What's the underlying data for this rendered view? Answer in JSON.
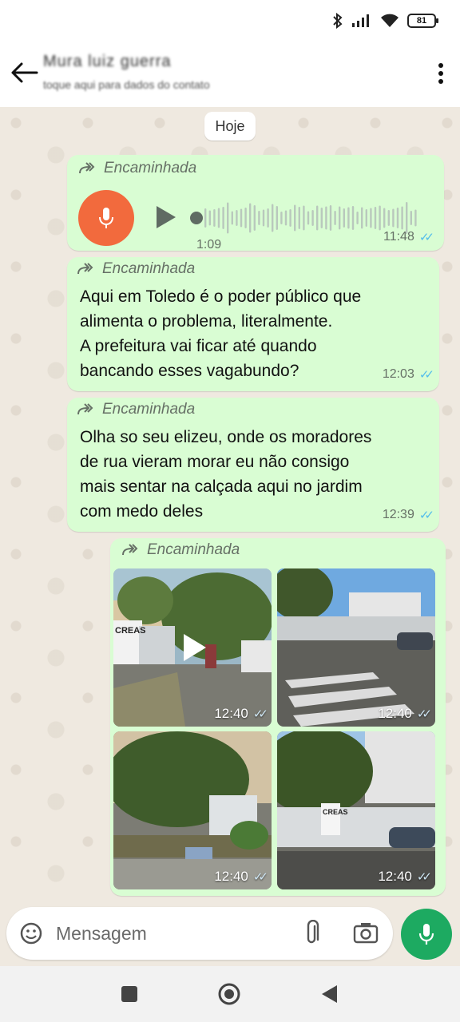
{
  "status_bar": {
    "battery": "81",
    "icons": [
      "bluetooth-icon",
      "signal-icon",
      "wifi-icon"
    ]
  },
  "header": {
    "contact_name": "Mura luiz guerra",
    "contact_subtitle": "toque aqui para dados do contato",
    "icons": [
      "back-arrow-icon",
      "more-vert-icon"
    ]
  },
  "chat": {
    "date_chip": "Hoje",
    "messages": [
      {
        "type": "audio",
        "forward_label": "Encaminhada",
        "duration": "1:09",
        "time": "11:48"
      },
      {
        "type": "text",
        "forward_label": "Encaminhada",
        "lines": [
          "Aqui em Toledo é o poder público que",
          "alimenta o problema, literalmente.",
          "A prefeitura vai ficar até quando",
          "bancando esses vagabundo?"
        ],
        "time": "12:03"
      },
      {
        "type": "text",
        "forward_label": "Encaminhada",
        "lines": [
          "Olha so seu elizeu, onde os moradores",
          "de rua vieram morar eu não consigo",
          "mais sentar na calçada aqui no jardim",
          "com medo deles"
        ],
        "time": "12:39"
      },
      {
        "type": "media",
        "forward_label": "Encaminhada",
        "items": [
          {
            "kind": "video",
            "sign_text": "CREAS",
            "time": "12:40"
          },
          {
            "kind": "photo",
            "time": "12:40"
          },
          {
            "kind": "photo",
            "time": "12:40"
          },
          {
            "kind": "photo",
            "sign_text": "CREAS",
            "time": "12:40"
          }
        ]
      }
    ]
  },
  "input": {
    "placeholder": "Mensagem",
    "icons": [
      "sticker-icon",
      "attach-icon",
      "camera-icon",
      "mic-icon"
    ]
  },
  "colors": {
    "bubble": "#d9fdd3",
    "accent_green": "#1daa61",
    "audio_orange": "#f26a3d",
    "ticks_blue": "#53bdeb"
  }
}
